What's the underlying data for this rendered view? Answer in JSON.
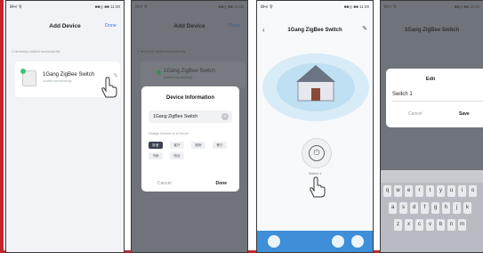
{
  "status_bar": {
    "carrier": "ⅡⅡ•ıl 令",
    "right": "■■◎ ■■ 11:00"
  },
  "screen1": {
    "title": "Add Device",
    "done": "Done",
    "found_label": "1 device(s) added successfully",
    "device_name": "1Gang ZigBee Switch",
    "device_status": "Added successfully"
  },
  "screen2": {
    "title": "Add Device",
    "done": "Done",
    "found_label": "1 device(s) added successfully",
    "device_name": "1Gang ZigBee Switch",
    "device_status": "Added successfully",
    "dialog": {
      "title": "Device Information",
      "name_value": "1Gang ZigBee Switch",
      "assign_label": "Assign Device to a Room",
      "rooms": [
        "卧室",
        "客厅",
        "厨房",
        "餐厅",
        "书房",
        "阳台"
      ],
      "cancel": "Cancel",
      "done": "Done"
    }
  },
  "screen3": {
    "title": "1Gang ZigBee Switch",
    "switch_label": "Switch 1"
  },
  "screen4": {
    "title": "1Gang ZigBee Switch",
    "dialog": {
      "title": "Edit",
      "value": "Switch 1",
      "cancel": "Cancel",
      "save": "Save"
    },
    "keyboard": {
      "row1": [
        "q",
        "w",
        "e",
        "r",
        "t",
        "y",
        "u",
        "i",
        "o"
      ],
      "row2": [
        "a",
        "s",
        "d",
        "f",
        "g",
        "h",
        "j",
        "k"
      ],
      "row3": [
        "z",
        "x",
        "c",
        "v",
        "b",
        "n",
        "m"
      ]
    }
  },
  "colors": {
    "accent": "#3a7cf0",
    "frame_red": "#c0262d",
    "online_green": "#3ec47a"
  }
}
